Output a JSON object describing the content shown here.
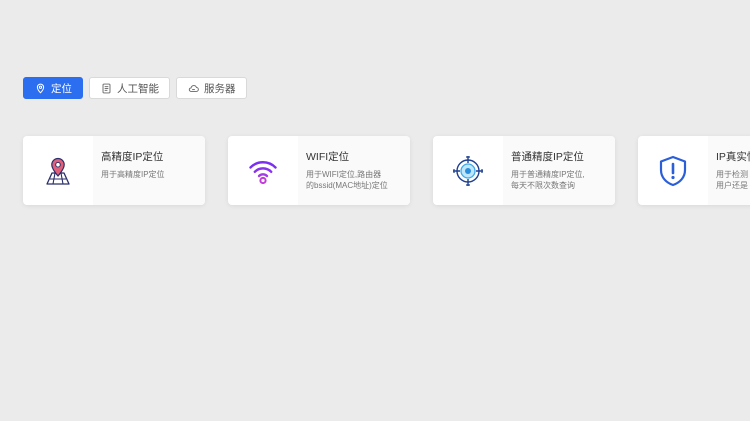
{
  "tabs": [
    {
      "label": "定位",
      "icon": "location-pin-icon",
      "active": true
    },
    {
      "label": "人工智能",
      "icon": "document-icon",
      "active": false
    },
    {
      "label": "服务器",
      "icon": "cloud-server-icon",
      "active": false
    }
  ],
  "cards": [
    {
      "title": "高精度IP定位",
      "desc": "用于高精度IP定位",
      "icon": "map-pin-icon"
    },
    {
      "title": "WIFI定位",
      "desc": "用于WIFI定位,路由器\n的bssid(MAC地址)定位",
      "icon": "wifi-icon"
    },
    {
      "title": "普通精度IP定位",
      "desc": "用于普通精度IP定位,\n每天不限次数查询",
      "icon": "crosshair-target-icon"
    },
    {
      "title": "IP真实性检测",
      "desc": "用于检测\n用户还是",
      "icon": "shield-alert-icon"
    }
  ],
  "colors": {
    "background": "#ebebeb",
    "accent": "#2b6ef0",
    "wifi": "#8a2be2",
    "pin": "#e0607a",
    "shield": "#2b5fd9"
  }
}
